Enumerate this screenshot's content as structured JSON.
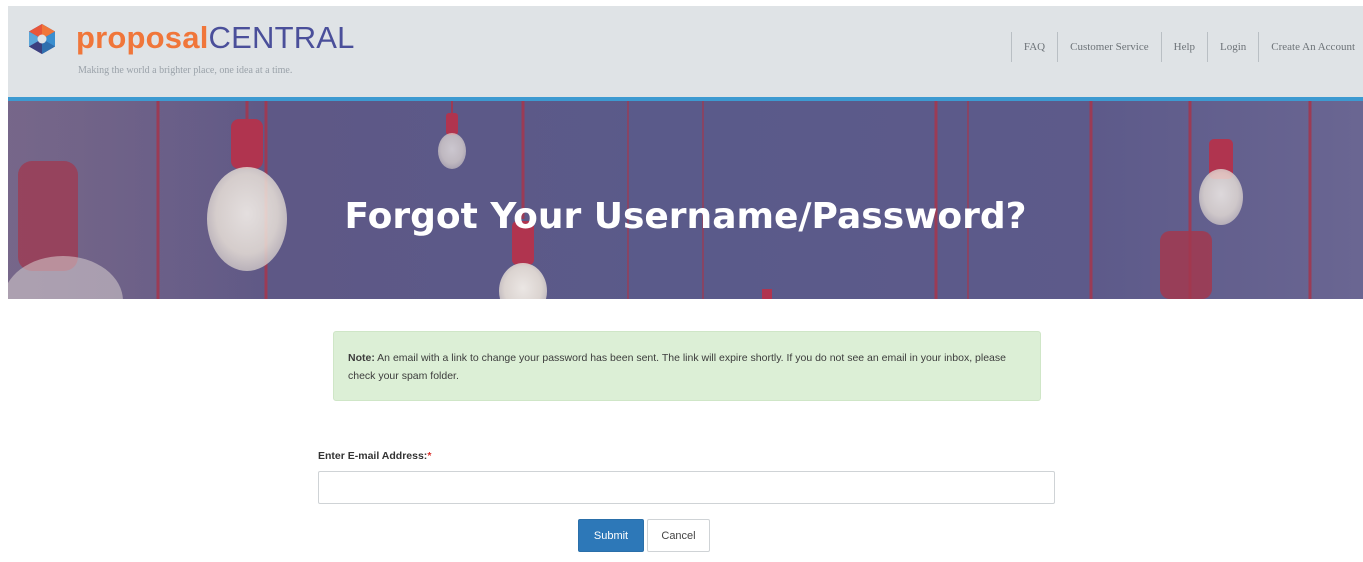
{
  "header": {
    "brand_part1": "proposal",
    "brand_part2": "CENTRAL",
    "tagline": "Making the world a brighter place, one idea at a time.",
    "nav": [
      "FAQ",
      "Customer Service",
      "Help",
      "Login",
      "Create An Account"
    ]
  },
  "hero": {
    "title": "Forgot Your Username/Password?"
  },
  "note": {
    "label": "Note:",
    "text": " An email with a link to change your password has been sent. The link will expire shortly. If you do not see an email in your inbox, please check your spam folder."
  },
  "form": {
    "email_label": "Enter E-mail Address:",
    "required_marker": "*",
    "email_value": "",
    "submit_label": "Submit",
    "cancel_label": "Cancel"
  },
  "colors": {
    "brand_orange": "#f0763a",
    "brand_indigo": "#4a4f9a",
    "header_rule": "#3d9ad1",
    "note_bg": "#dcefd6",
    "submit_bg": "#2d78b8"
  }
}
